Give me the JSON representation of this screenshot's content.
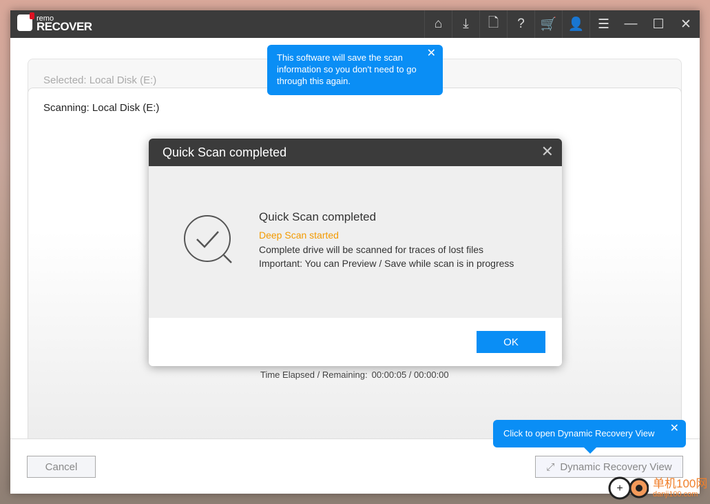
{
  "app": {
    "logo_top": "remo",
    "logo_bottom": "RECOVER"
  },
  "toolbar": [
    {
      "icon": "home-icon",
      "glyph": "⌂"
    },
    {
      "icon": "import-icon",
      "glyph": "⤓"
    },
    {
      "icon": "add-file-icon",
      "glyph": "🗋"
    },
    {
      "icon": "help-icon",
      "glyph": "?"
    },
    {
      "icon": "cart-icon",
      "glyph": "🛒"
    },
    {
      "icon": "user-icon",
      "glyph": "👤"
    },
    {
      "icon": "menu-icon",
      "glyph": "☰"
    },
    {
      "icon": "minimize-icon",
      "glyph": "—"
    },
    {
      "icon": "maximize-icon",
      "glyph": "☐"
    },
    {
      "icon": "close-icon",
      "glyph": "✕"
    }
  ],
  "selected": "Selected: Local Disk (E:)",
  "scanning": "Scanning: Local Disk (E:)",
  "time": {
    "label": "Time Elapsed / Remaining:",
    "value": "00:00:05 / 00:00:00"
  },
  "tooltip_save": "This software will save the scan information so you don't need to go through this again.",
  "tooltip_dynamic": "Click to open Dynamic Recovery View",
  "footer": {
    "cancel": "Cancel",
    "dynamic": "Dynamic Recovery View"
  },
  "modal": {
    "title": "Quick Scan completed",
    "heading": "Quick Scan completed",
    "deep": "Deep Scan started",
    "line1": "Complete drive will be scanned for traces of lost files",
    "line2": "Important: You can Preview / Save while scan is in progress",
    "ok": "OK"
  },
  "colors": {
    "accent": "#0a8ef5",
    "warning": "#f39a00",
    "titlebar": "#3b3b3b"
  },
  "watermark": {
    "cn": "单机100网",
    "url": "danji100.com"
  }
}
